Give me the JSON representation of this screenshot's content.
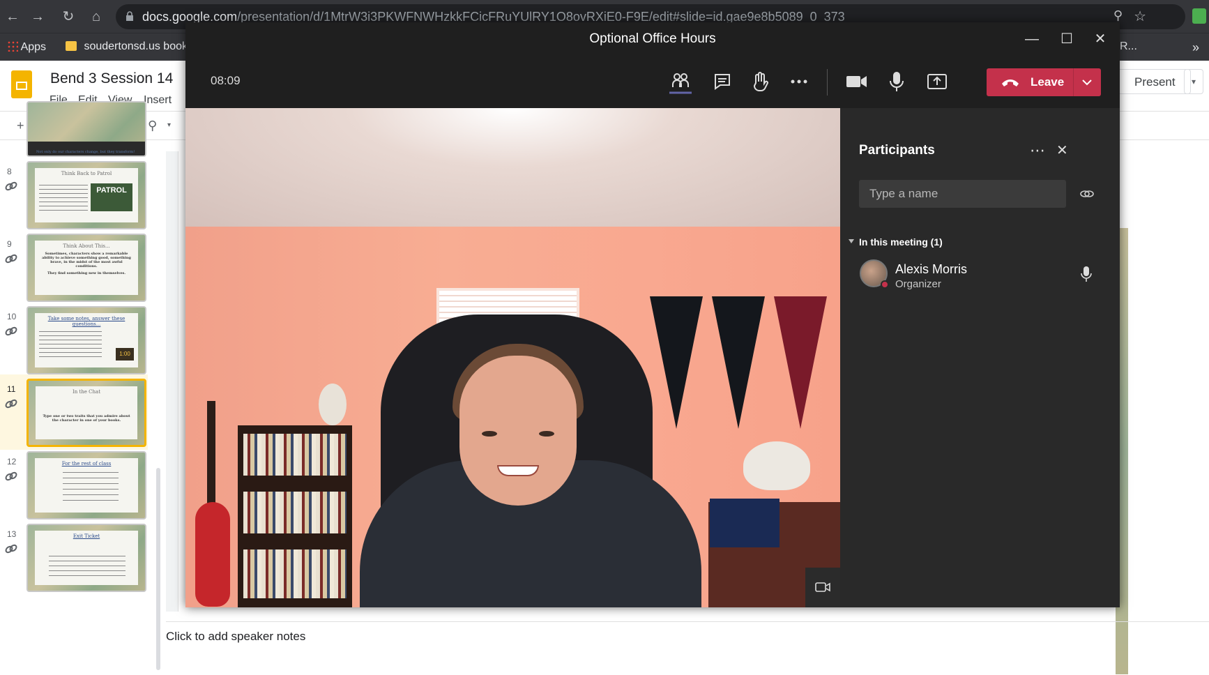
{
  "browser": {
    "url_host": "docs.google.com",
    "url_path": "/presentation/d/1MtrW3i3PKWFNWHzkkFCicFRuYUlRY1O8ovRXiE0-F9E/edit#slide=id.gae9e8b5089_0_373",
    "bookmarks": [
      "Apps",
      "soudertonsd.us bookr",
      "R..."
    ]
  },
  "slides": {
    "doc_title": "Bend 3  Session 14",
    "menus": [
      "File",
      "Edit",
      "View",
      "Insert"
    ],
    "present_label": "Present",
    "speaker_notes_placeholder": "Click to add speaker notes",
    "thumbnails": [
      {
        "number": "8",
        "title": "Think Back to Patrol",
        "badge": "PATROL"
      },
      {
        "number": "9",
        "title": "Think About This...",
        "body": "Sometimes, characters show a remarkable ability to achieve something good, something brave, in the midst of the most awful conditions.",
        "body2": "They find something new in themselves."
      },
      {
        "number": "10",
        "title": "Take some notes, answer these questions...",
        "timer": "1:00"
      },
      {
        "number": "11",
        "title": "In the Chat",
        "body": "Type one or two traits that you admire about the character in one of your books."
      },
      {
        "number": "12",
        "title": "For the rest of class"
      },
      {
        "number": "13",
        "title": "Exit Ticket"
      }
    ],
    "top_slide_caption": "Not only do our characters change, but they transform!"
  },
  "teams": {
    "meeting_title": "Optional Office Hours",
    "timer": "08:09",
    "leave_label": "Leave",
    "panel": {
      "title": "Participants",
      "search_placeholder": "Type a name",
      "section_label": "In this meeting (1)",
      "participants": [
        {
          "name": "Alexis Morris",
          "role": "Organizer"
        }
      ]
    },
    "colors": {
      "leave": "#c4314b",
      "panel_bg": "#292929",
      "bar_bg": "#1f1f1f"
    }
  }
}
